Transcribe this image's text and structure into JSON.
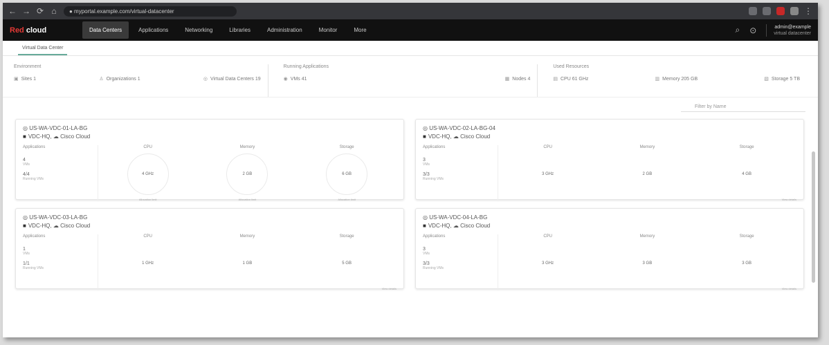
{
  "browser": {
    "url": "● myportal.example.com/virtual-datacenter"
  },
  "app": {
    "brand_prefix": "Red",
    "brand_suffix": "cloud",
    "nav": [
      "Data Centers",
      "Applications",
      "Networking",
      "Libraries",
      "Administration",
      "Monitor",
      "More"
    ],
    "user_name": "admin@example",
    "user_org": "virtual datacenter"
  },
  "subtab": "Virtual Data Center",
  "summary": {
    "groups": [
      {
        "title": "Environment",
        "items": [
          "Sites 1",
          "Organizations 1",
          "Virtual Data Centers 19"
        ]
      },
      {
        "title": "Running Applications",
        "items": [
          "VMs 41",
          "Nodes 4"
        ]
      },
      {
        "title": "Used Resources",
        "items": [
          "CPU 61 GHz",
          "Memory 205 GB",
          "Storage 5 TB"
        ]
      }
    ]
  },
  "filter_placeholder": "Filter by Name",
  "card_labels": {
    "applications": "Applications",
    "cpu": "CPU",
    "memory": "Memory",
    "storage": "Storage",
    "vms_label": "VMs",
    "running_label": "Running VMs",
    "allocated": "Allocation limit",
    "view_details": "View details"
  },
  "cards": [
    {
      "title": "US-WA-VDC-01-LA-BG",
      "org": "VDC-HQ",
      "cloud": "Cisco Cloud",
      "vms": "4",
      "running": "4/4",
      "cpu": "4 GHz",
      "memory": "2 GB",
      "storage": "6 GB",
      "style": "gauge"
    },
    {
      "title": "US-WA-VDC-02-LA-BG-04",
      "org": "VDC-HQ",
      "cloud": "Cisco Cloud",
      "vms": "3",
      "running": "3/3",
      "cpu": "3 GHz",
      "memory": "2 GB",
      "storage": "4 GB",
      "style": "plain"
    },
    {
      "title": "US-WA-VDC-03-LA-BG",
      "org": "VDC-HQ",
      "cloud": "Cisco Cloud",
      "vms": "1",
      "running": "1/1",
      "cpu": "1 GHz",
      "memory": "1 GB",
      "storage": "5 GB",
      "style": "plain"
    },
    {
      "title": "US-WA-VDC-04-LA-BG",
      "org": "VDC-HQ",
      "cloud": "Cisco Cloud",
      "vms": "3",
      "running": "3/3",
      "cpu": "3 GHz",
      "memory": "3 GB",
      "storage": "3 GB",
      "style": "plain"
    }
  ],
  "colors": {
    "header": "#111111",
    "brand_accent": "#e53935",
    "subtab_underline": "#66aa99"
  }
}
